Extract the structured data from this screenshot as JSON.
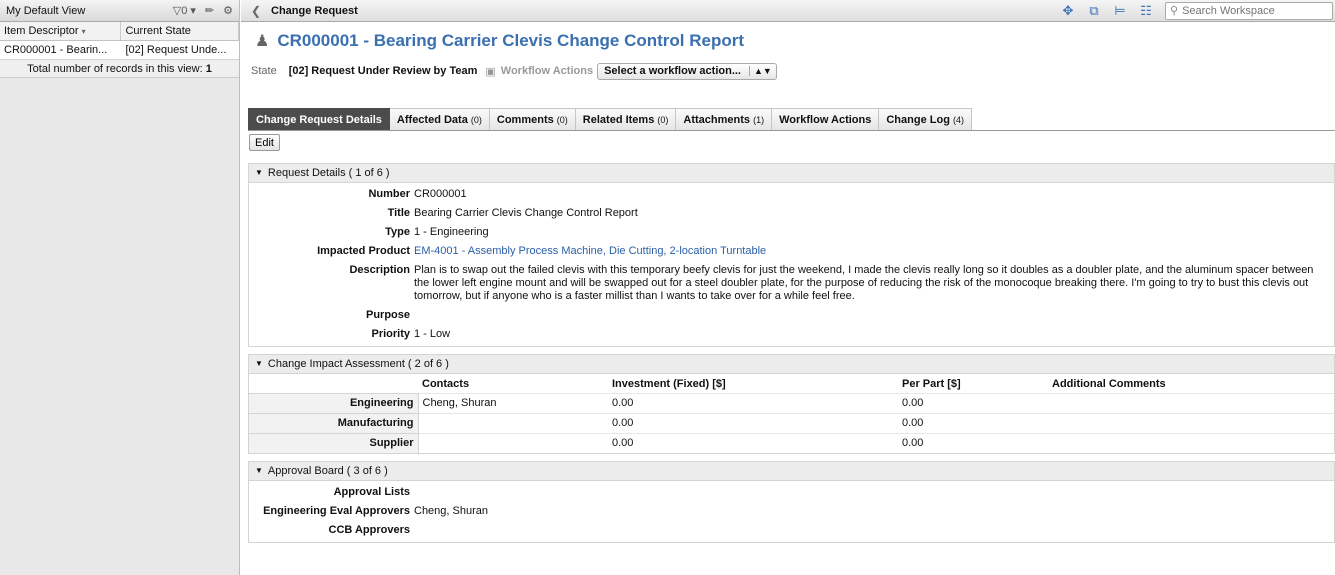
{
  "left_pane": {
    "view_name": "My Default View",
    "filter_count": "0",
    "columns": [
      "Item Descriptor",
      "Current State"
    ],
    "rows": [
      {
        "descriptor": "CR000001 - Bearin...",
        "state": "[02] Request Unde..."
      }
    ],
    "total_text": "Total number of records in this view:",
    "total_count": "1"
  },
  "topbar": {
    "page_label": "Change Request",
    "search_placeholder": "Search Workspace"
  },
  "record": {
    "title": "CR000001 - Bearing Carrier Clevis Change Control Report",
    "state_label": "State",
    "state_value": "[02] Request Under Review by Team",
    "workflow_label": "Workflow Actions",
    "workflow_select": "Select a workflow action..."
  },
  "tabs": [
    {
      "label": "Change Request Details",
      "count": ""
    },
    {
      "label": "Affected Data",
      "count": "(0)"
    },
    {
      "label": "Comments",
      "count": "(0)"
    },
    {
      "label": "Related Items",
      "count": "(0)"
    },
    {
      "label": "Attachments",
      "count": "(1)"
    },
    {
      "label": "Workflow Actions",
      "count": ""
    },
    {
      "label": "Change Log",
      "count": "(4)"
    }
  ],
  "edit_label": "Edit",
  "request_details": {
    "heading": "Request Details ( 1 of 6 )",
    "number_label": "Number",
    "number": "CR000001",
    "title_label": "Title",
    "title": "Bearing Carrier Clevis Change Control Report",
    "type_label": "Type",
    "type": "1 - Engineering",
    "product_label": "Impacted Product",
    "product": "EM-4001 - Assembly Process Machine, Die Cutting, 2-location Turntable",
    "description_label": "Description",
    "description": "Plan is to swap out the failed clevis with this temporary beefy clevis for just the weekend, I made the clevis really long so it doubles as a doubler plate, and the aluminum spacer between the lower left engine mount and will be swapped out for a steel doubler plate, for the purpose of reducing the risk of the monocoque breaking there. I'm going to try to bust this clevis out tomorrow, but if anyone who is a faster millist than I wants to take over for a while feel free.",
    "purpose_label": "Purpose",
    "purpose": "",
    "priority_label": "Priority",
    "priority": "1 - Low"
  },
  "impact": {
    "heading": "Change Impact Assessment ( 2 of 6 )",
    "columns": [
      "Contacts",
      "Investment (Fixed) [$]",
      "Per Part [$]",
      "Additional Comments"
    ],
    "rows": [
      {
        "label": "Engineering",
        "contacts": "Cheng, Shuran",
        "investment": "0.00",
        "per_part": "0.00",
        "comments": ""
      },
      {
        "label": "Manufacturing",
        "contacts": "",
        "investment": "0.00",
        "per_part": "0.00",
        "comments": ""
      },
      {
        "label": "Supplier",
        "contacts": "",
        "investment": "0.00",
        "per_part": "0.00",
        "comments": ""
      }
    ]
  },
  "approval": {
    "heading": "Approval Board ( 3 of 6 )",
    "lists_label": "Approval Lists",
    "eng_label": "Engineering Eval Approvers",
    "eng_value": "Cheng, Shuran",
    "ccb_label": "CCB Approvers",
    "ccb_value": ""
  }
}
